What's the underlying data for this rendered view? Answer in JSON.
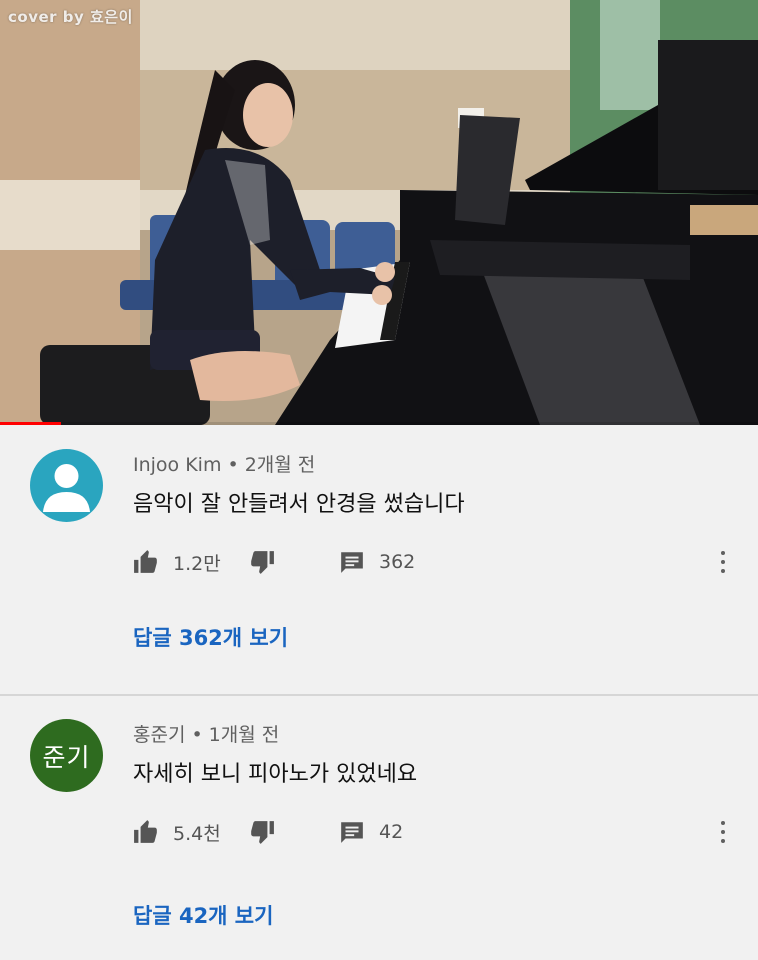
{
  "video": {
    "watermark": "cover by 효은이",
    "progress_percent": 8
  },
  "comments": [
    {
      "author": "Injoo Kim",
      "time": "2개월 전",
      "text": "음악이 잘 안들려서 안경을 썼습니다",
      "likes": "1.2만",
      "replies_count": "362",
      "view_replies": "답글 362개 보기",
      "avatar_text": "",
      "avatar_color": "#2aa5bf"
    },
    {
      "author": "홍준기",
      "time": "1개월 전",
      "text": "자세히 보니 피아노가 있었네요",
      "likes": "5.4천",
      "replies_count": "42",
      "view_replies": "답글 42개 보기",
      "avatar_text": "준기",
      "avatar_color": "#2e6b1f"
    }
  ],
  "colors": {
    "link": "#1a65c0",
    "meta": "#606060",
    "background": "#f1f1f1"
  }
}
